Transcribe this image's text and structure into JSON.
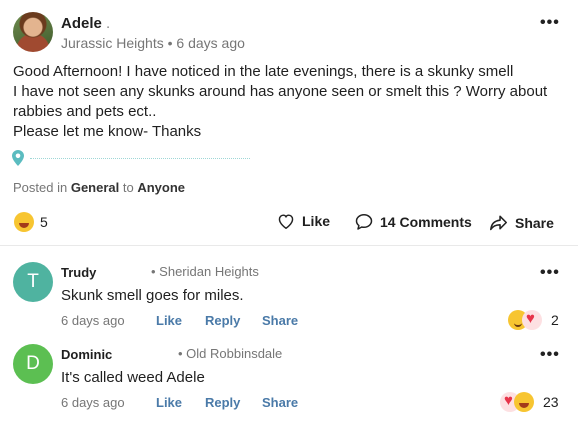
{
  "post": {
    "author": "Adele",
    "author_suffix": ".",
    "neighborhood": "Jurassic Heights",
    "time": "6 days ago",
    "body": [
      "Good Afternoon!  I have noticed in the late evenings, there is a skunky smell",
      "I have not seen any skunks around has anyone seen or smelt this ? Worry about",
      "rabbies and pets ect..",
      "Please let me know- Thanks"
    ],
    "posted_in_prefix": "Posted in",
    "category": "General",
    "to_word": "to",
    "audience": "Anyone",
    "reaction_count": "5",
    "like_label": "Like",
    "comments_label": "14 Comments",
    "share_label": "Share",
    "more_glyph": "•••"
  },
  "comments": [
    {
      "initial": "T",
      "name": "Trudy",
      "neighborhood": "• Sheridan Heights",
      "text": "Skunk smell goes for miles.",
      "time": "6 days ago",
      "like": "Like",
      "reply": "Reply",
      "share": "Share",
      "reaction_count": "2",
      "avatar_color": "#4fb3a0"
    },
    {
      "initial": "D",
      "name": "Dominic",
      "neighborhood": "• Old Robbinsdale",
      "text": "It's called weed Adele",
      "time": "6 days ago",
      "like": "Like",
      "reply": "Reply",
      "share": "Share",
      "reaction_count": "23",
      "avatar_color": "#5cbf52"
    }
  ],
  "colors": {
    "link_blue": "#4a7aa8",
    "location_pin": "#5bbcc0",
    "meta_gray": "#767676"
  }
}
